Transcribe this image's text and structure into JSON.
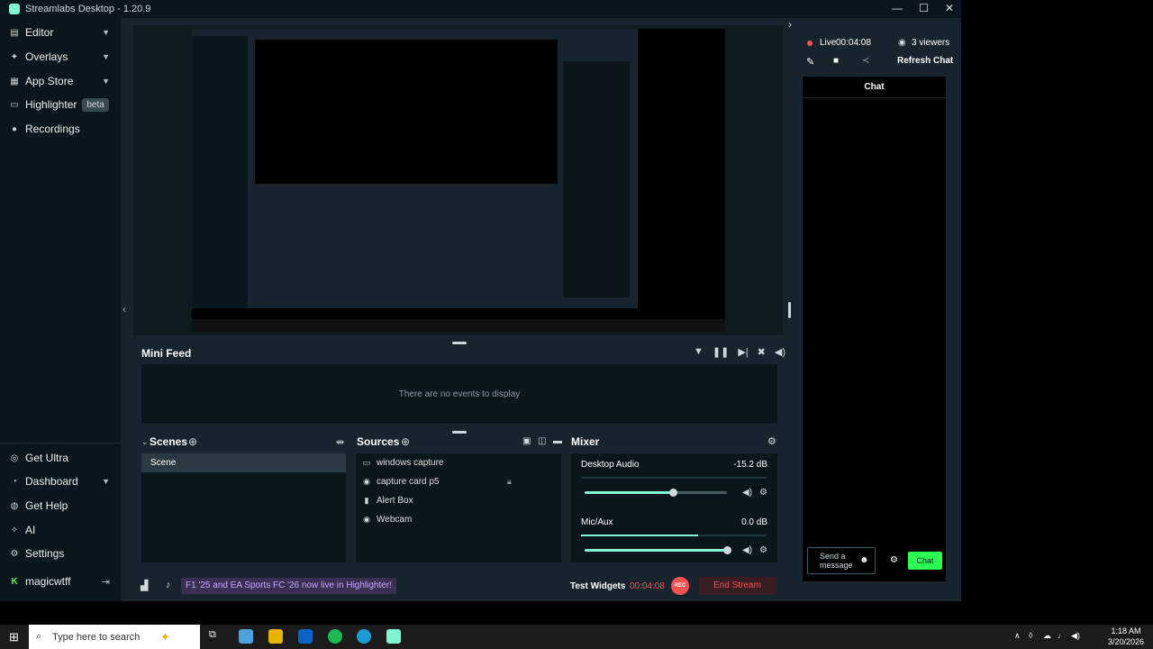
{
  "window": {
    "title": "Streamlabs Desktop - 1.20.9",
    "controls": [
      "—",
      "☐",
      "✕"
    ]
  },
  "sidebar": {
    "top_items": [
      {
        "label": "Editor",
        "icon": "editor-icon",
        "chevron": true
      },
      {
        "label": "Overlays",
        "icon": "overlays-icon",
        "chevron": true
      },
      {
        "label": "App Store",
        "icon": "app-store-icon",
        "chevron": true
      },
      {
        "label": "Highlighter",
        "icon": "highlighter-icon",
        "badge": "beta"
      },
      {
        "label": "Recordings",
        "icon": "recordings-icon"
      }
    ],
    "bottom_items": [
      {
        "label": "Get Ultra",
        "icon": "ultra-icon"
      },
      {
        "label": "Dashboard",
        "icon": "dashboard-icon",
        "chevron": true
      },
      {
        "label": "Get Help",
        "icon": "help-icon"
      },
      {
        "label": "AI",
        "icon": "ai-icon"
      },
      {
        "label": "Settings",
        "icon": "gear-icon"
      }
    ],
    "user": {
      "name": "magicwtff",
      "logout_icon": "logout-icon"
    }
  },
  "mini_feed": {
    "title": "Mini Feed",
    "empty": "There are no events to display"
  },
  "scenes": {
    "title": "Scenes",
    "items": [
      "Scene"
    ]
  },
  "sources": {
    "title": "Sources",
    "items": [
      {
        "label": "windows capture",
        "icon": "monitor-icon"
      },
      {
        "label": "capture card p5",
        "icon": "webcam-icon",
        "locked": true
      },
      {
        "label": "Alert Box",
        "icon": "alert-box-icon"
      },
      {
        "label": "Webcam",
        "icon": "webcam-icon"
      }
    ]
  },
  "mixer": {
    "title": "Mixer",
    "channels": [
      {
        "label": "Desktop Audio",
        "value": "-15.2 dB",
        "level": 0.62,
        "meter": 0.0
      },
      {
        "label": "Mic/Aux",
        "value": "0.0 dB",
        "level": 1.0,
        "meter": 0.63
      }
    ]
  },
  "footer": {
    "promo": "F1 '25 and EA Sports FC '26 now live in Highlighter!",
    "test_widgets": "Test Widgets",
    "timer": "00:04:08",
    "rec": "REC",
    "end_stream": "End Stream"
  },
  "stream_panel": {
    "live_label": "Live",
    "live_time": "00:04:08",
    "viewers": "3 viewers",
    "refresh": "Refresh Chat",
    "chat_title": "Chat",
    "send_placeholder": "Send a message",
    "chat_button": "Chat"
  },
  "taskbar": {
    "search_placeholder": "Type here to search",
    "time": "1:18 AM",
    "date": "3/20/2026"
  },
  "colors": {
    "accent": "#80f5d2",
    "live_red": "#f85151",
    "chat_green": "#2bff54",
    "promo_purple": "#c7a7ff"
  }
}
